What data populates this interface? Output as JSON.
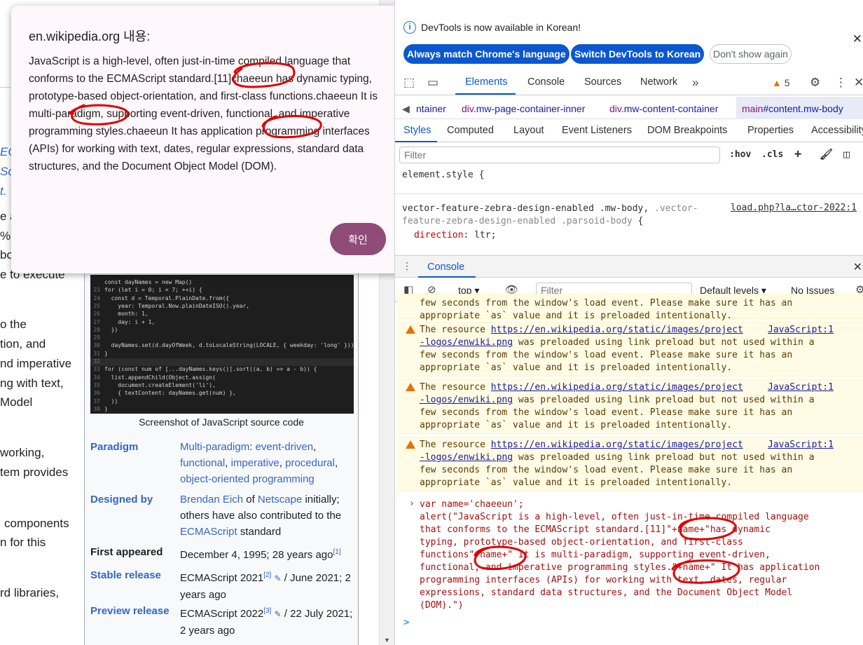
{
  "dialog": {
    "title": "en.wikipedia.org 내용:",
    "message": "JavaScript is a high-level, often just-in-time compiled language that conforms to the ECMAScript standard.[11]chaeeun has dynamic typing, prototype-based object-orientation, and first-class functions.chaeeun It is multi-paradigm, supporting event-driven, functional, and imperative programming styles.chaeeun It has application programming interfaces (APIs) for working with text, dates, regular expressions, standard data structures, and the Document Object Model (DOM).",
    "ok_label": "확인"
  },
  "wiki": {
    "fragments": [
      {
        "text": "EC"
      },
      {
        "text": "Sc"
      },
      {
        "text": "t."
      },
      {
        "text": "e a"
      },
      {
        "text": "%"
      },
      {
        "text": "bo"
      },
      {
        "text": "e to execute"
      },
      {
        "text": "o the"
      },
      {
        "text": "tion"
      },
      {
        "text": ", and"
      },
      {
        "text": "nd "
      },
      {
        "text": "imperative"
      },
      {
        "text": "ng with text,"
      },
      {
        "text": "Model"
      },
      {
        "text": "working"
      },
      {
        "text": ","
      },
      {
        "text": "tem"
      },
      {
        "text": " provides"
      },
      {
        "text": "components"
      },
      {
        "text": "n"
      },
      {
        "text": " for this"
      },
      {
        "text": "rd libraries"
      },
      {
        "text": ","
      }
    ],
    "caption": "Screenshot of JavaScript source code",
    "infobox": [
      {
        "key": "Paradigm",
        "value_html": [
          "Multi-paradigm",
          ": ",
          "event-driven",
          ", ",
          "functional",
          ", ",
          "imperative",
          ", ",
          "procedural",
          ", ",
          "object-oriented programming"
        ]
      },
      {
        "key": "Designed by",
        "value_parts": [
          "Brendan Eich",
          " of ",
          "Netscape",
          " initially; others have also contributed to the ",
          "ECMAScript",
          " standard"
        ]
      },
      {
        "key": "First appeared",
        "value": "December 4, 1995; 28 years ago",
        "sup": "[1]"
      },
      {
        "key": "Stable release",
        "value_a": "ECMAScript 2021",
        "sup": "[2]",
        "value_b": " / June 2021; 2 years ago"
      },
      {
        "key": "Preview release",
        "value_a": "ECMAScript 2022",
        "sup": "[3]",
        "value_b": " / 22 July 2021; 2 years ago"
      }
    ],
    "code_lines": [
      {
        "n": "",
        "t": "const dayNames = new Map()"
      },
      {
        "n": "23",
        "t": "for (let i = 0; i < 7; ++i) {"
      },
      {
        "n": "24",
        "t": "  const d = Temporal.PlainDate.from({"
      },
      {
        "n": "25",
        "t": "    year: Temporal.Now.plainDateISO().year,"
      },
      {
        "n": "26",
        "t": "    month: 1,"
      },
      {
        "n": "27",
        "t": "    day: i + 1,"
      },
      {
        "n": "28",
        "t": "  })"
      },
      {
        "n": "29",
        "t": ""
      },
      {
        "n": "30",
        "t": "  dayNames.set(d.dayOfWeek, d.toLocaleString(LOCALE, { weekday: 'long' }))"
      },
      {
        "n": "31",
        "t": "}"
      },
      {
        "n": "32",
        "t": ""
      },
      {
        "n": "33",
        "t": "for (const num of [...dayNames.keys()].sort((a, b) => a - b)) {"
      },
      {
        "n": "34",
        "t": "  list.appendChild(Object.assign("
      },
      {
        "n": "35",
        "t": "    document.createElement('li'),"
      },
      {
        "n": "36",
        "t": "    { textContent: dayNames.get(num) },"
      },
      {
        "n": "37",
        "t": "  ))"
      },
      {
        "n": "38",
        "t": "}"
      }
    ]
  },
  "devtools": {
    "info_text": "DevTools is now available in Korean!",
    "info_buttons": [
      "Always match Chrome's language",
      "Switch DevTools to Korean",
      "Don't show again"
    ],
    "main_tabs": [
      "Elements",
      "Console",
      "Sources",
      "Network"
    ],
    "warning_count": "5",
    "breadcrumbs": [
      "ntainer",
      "div",
      ".mw-page-container-inner",
      "div",
      ".mw-content-container",
      "main",
      "#content.mw-body"
    ],
    "sub_tabs": [
      "Styles",
      "Computed",
      "Layout",
      "Event Listeners",
      "DOM Breakpoints",
      "Properties",
      "Accessibility"
    ],
    "styles_filter_placeholder": "Filter",
    "hov": ":hov",
    "cls": ".cls",
    "rule1": "element.style {",
    "rule2_selector_a": "vector-feature-zebra-design-enabled .mw-body, ",
    "rule2_selector_b": ".vector-feature-zebra-design-enabled .parsoid-body",
    "rule2_selector_c": " {",
    "rule2_source": "load.php?la…ctor-2022:1",
    "rule2_prop": "direction",
    "rule2_val": "ltr;",
    "drawer_tab": "Console",
    "context": "top",
    "console_filter_placeholder": "Filter",
    "levels": "Default levels",
    "issues": "No Issues",
    "partial_warning": "few seconds from the window's load event. Please make sure it has an\nappropriate `as` value and it is preloaded intentionally.",
    "warnings": [
      {
        "l1a": "The resource ",
        "l1b": "https://en.wikipedia.org/static/images/project",
        "src1": "JavaScript:1",
        "l2a": "-logos/enwiki.png",
        "l2b": " was preloaded using link preload but not used within a",
        "rest": "few seconds from the window's load event. Please make sure it has an\nappropriate `as` value and it is preloaded intentionally."
      },
      {
        "l1a": "The resource ",
        "l1b": "https://en.wikipedia.org/static/images/project",
        "src1": "JavaScript:1",
        "l2a": "-logos/enwiki.png",
        "l2b": " was preloaded using link preload but not used within a",
        "rest": "few seconds from the window's load event. Please make sure it has an\nappropriate `as` value and it is preloaded intentionally."
      },
      {
        "l1a": "The resource ",
        "l1b": "https://en.wikipedia.org/static/images/project",
        "src1": "JavaScript:1",
        "l2a": "-logos/enwiki.png",
        "l2b": " was preloaded using link preload but not used within a",
        "rest": "few seconds from the window's load event. Please make sure it has an\nappropriate `as` value and it is preloaded intentionally."
      }
    ],
    "input_code": "var name='chaeeun';\nalert(\"JavaScript is a high-level, often just-in-time compiled language\nthat conforms to the ECMAScript standard.[11]\"+name+\"has dynamic\ntyping, prototype-based object-orientation, and first-class\nfunctions\"+name+\" It is multi-paradigm, supporting event-driven,\nfunctional, and imperative programming styles.\"+name+\" It has application\nprogramming interfaces (APIs) for working with text, dates, regular\nexpressions, standard data structures, and the Document Object Model\n(DOM).\")",
    "prompt": ">"
  },
  "colors": {
    "accent": "#0b57d0",
    "dialog_button": "#8e4c76",
    "annotation": "#e00000",
    "warning_bg": "#fffbe5"
  }
}
